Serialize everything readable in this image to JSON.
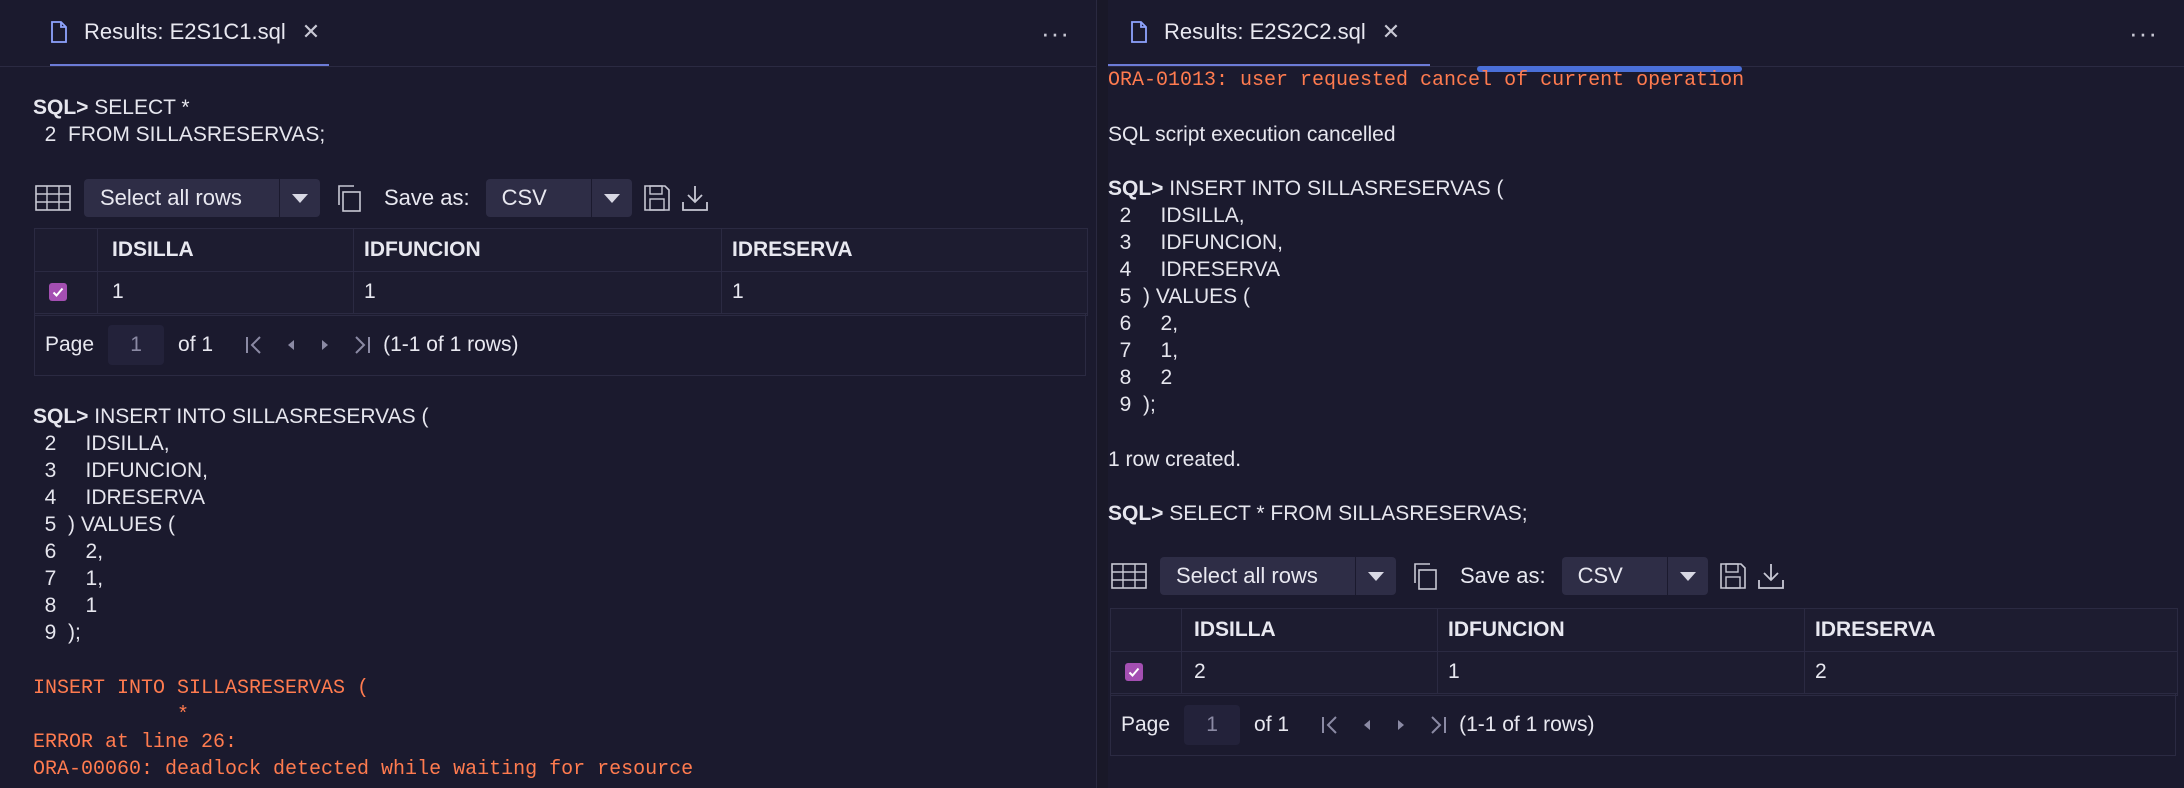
{
  "left": {
    "tab_title": "Results: E2S1C1.sql",
    "more": "···",
    "lines_a": [
      {
        "prompt": "SQL>",
        "text": " SELECT *"
      },
      {
        "prompt": "",
        "text": "  2  FROM SILLASRESERVAS;"
      }
    ],
    "toolbar": {
      "select_label": "Select all rows",
      "save_as_label": "Save as:",
      "format": "CSV"
    },
    "columns": [
      "IDSILLA",
      "IDFUNCION",
      "IDRESERVA"
    ],
    "rows": [
      [
        "1",
        "1",
        "1"
      ]
    ],
    "pager": {
      "page_label": "Page",
      "page_value": "1",
      "of_label": "of 1",
      "range": "(1-1 of 1 rows)"
    },
    "lines_b": [
      {
        "prompt": "SQL>",
        "text": " INSERT INTO SILLASRESERVAS ("
      },
      {
        "prompt": "",
        "text": "  2     IDSILLA,"
      },
      {
        "prompt": "",
        "text": "  3     IDFUNCION,"
      },
      {
        "prompt": "",
        "text": "  4     IDRESERVA"
      },
      {
        "prompt": "",
        "text": "  5  ) VALUES ("
      },
      {
        "prompt": "",
        "text": "  6     2,"
      },
      {
        "prompt": "",
        "text": "  7     1,"
      },
      {
        "prompt": "",
        "text": "  8     1"
      },
      {
        "prompt": "",
        "text": "  9  );"
      }
    ],
    "errors": [
      "INSERT INTO SILLASRESERVAS (",
      "            *",
      "ERROR at line 26:",
      "ORA-00060: deadlock detected while waiting for resource"
    ]
  },
  "right": {
    "tab_title": "Results: E2S2C2.sql",
    "more": "···",
    "error_top": "ORA-01013: user requested cancel of current operation",
    "cancel_msg": "SQL script execution cancelled",
    "lines_a": [
      {
        "prompt": "SQL>",
        "text": " INSERT INTO SILLASRESERVAS ("
      },
      {
        "prompt": "",
        "text": "  2     IDSILLA,"
      },
      {
        "prompt": "",
        "text": "  3     IDFUNCION,"
      },
      {
        "prompt": "",
        "text": "  4     IDRESERVA"
      },
      {
        "prompt": "",
        "text": "  5  ) VALUES ("
      },
      {
        "prompt": "",
        "text": "  6     2,"
      },
      {
        "prompt": "",
        "text": "  7     1,"
      },
      {
        "prompt": "",
        "text": "  8     2"
      },
      {
        "prompt": "",
        "text": "  9  );"
      }
    ],
    "row_created": "1 row created.",
    "select_line": {
      "prompt": "SQL>",
      "text": " SELECT * FROM SILLASRESERVAS;"
    },
    "toolbar": {
      "select_label": "Select all rows",
      "save_as_label": "Save as:",
      "format": "CSV"
    },
    "columns": [
      "IDSILLA",
      "IDFUNCION",
      "IDRESERVA"
    ],
    "rows": [
      [
        "2",
        "1",
        "2"
      ]
    ],
    "pager": {
      "page_label": "Page",
      "page_value": "1",
      "of_label": "of 1",
      "range": "(1-1 of 1 rows)"
    }
  },
  "colors": {
    "background": "#1b1a2e",
    "error": "#ff7b4f",
    "accent": "#6c7bd6",
    "checkbox": "#a44fb2",
    "progress": "#4a6fd8"
  },
  "icons": [
    "file-icon",
    "close-icon",
    "more-icon",
    "grid-icon",
    "copy-icon",
    "save-icon",
    "download-icon",
    "first-page-icon",
    "prev-page-icon",
    "next-page-icon",
    "last-page-icon",
    "checkbox-icon"
  ]
}
